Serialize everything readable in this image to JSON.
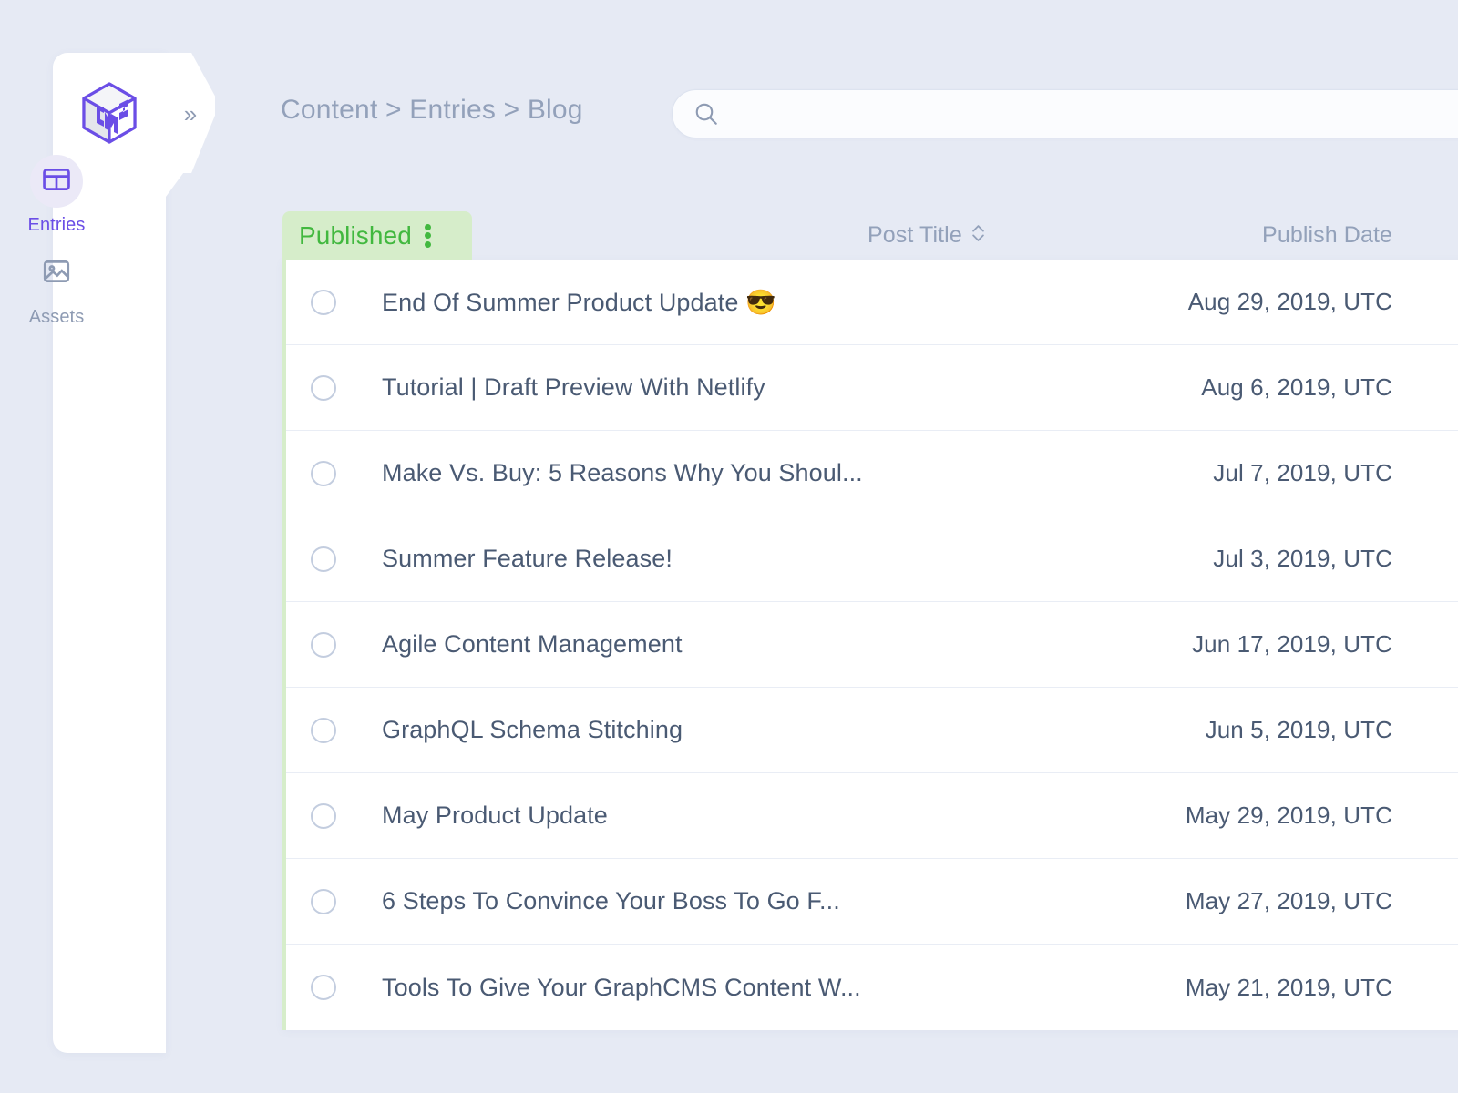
{
  "app": {
    "logo_name": "graphcms-cube-logo",
    "background_color": "#e6eaf4",
    "accent_color": "#6b4ee6",
    "status_color": "#42b83f"
  },
  "sidebar": {
    "expand_label": "»",
    "items": [
      {
        "label": "Entries",
        "icon": "table-grid-icon",
        "active": true
      },
      {
        "label": "Assets",
        "icon": "image-icon",
        "active": false
      }
    ]
  },
  "header": {
    "breadcrumb": "Content > Entries > Blog",
    "breadcrumb_parts": [
      "Content",
      "Entries",
      "Blog"
    ]
  },
  "search": {
    "value": "",
    "placeholder": "",
    "icon": "search-icon"
  },
  "table": {
    "status_tab": {
      "label": "Published",
      "menu_icon": "kebab-menu-icon"
    },
    "columns": [
      {
        "label": "Post Title",
        "sortable": true,
        "sort_icon": "sort-updown-icon"
      },
      {
        "label": "Publish Date",
        "sortable": false
      }
    ],
    "rows": [
      {
        "title": "End Of Summer Product Update 😎",
        "date": "Aug 29, 2019, UTC",
        "selected": false
      },
      {
        "title": "Tutorial | Draft Preview With Netlify",
        "date": "Aug 6, 2019, UTC",
        "selected": false
      },
      {
        "title": "Make Vs. Buy: 5 Reasons Why You Shoul...",
        "date": "Jul 7, 2019, UTC",
        "selected": false
      },
      {
        "title": "Summer Feature Release!",
        "date": "Jul 3, 2019, UTC",
        "selected": false
      },
      {
        "title": "Agile Content Management",
        "date": "Jun 17, 2019, UTC",
        "selected": false
      },
      {
        "title": "GraphQL Schema Stitching",
        "date": "Jun 5, 2019, UTC",
        "selected": false
      },
      {
        "title": "May Product Update",
        "date": "May 29, 2019, UTC",
        "selected": false
      },
      {
        "title": "6 Steps To Convince Your Boss To Go F...",
        "date": "May 27, 2019, UTC",
        "selected": false
      },
      {
        "title": "Tools To Give Your GraphCMS Content W...",
        "date": "May 21, 2019, UTC",
        "selected": false
      }
    ]
  }
}
